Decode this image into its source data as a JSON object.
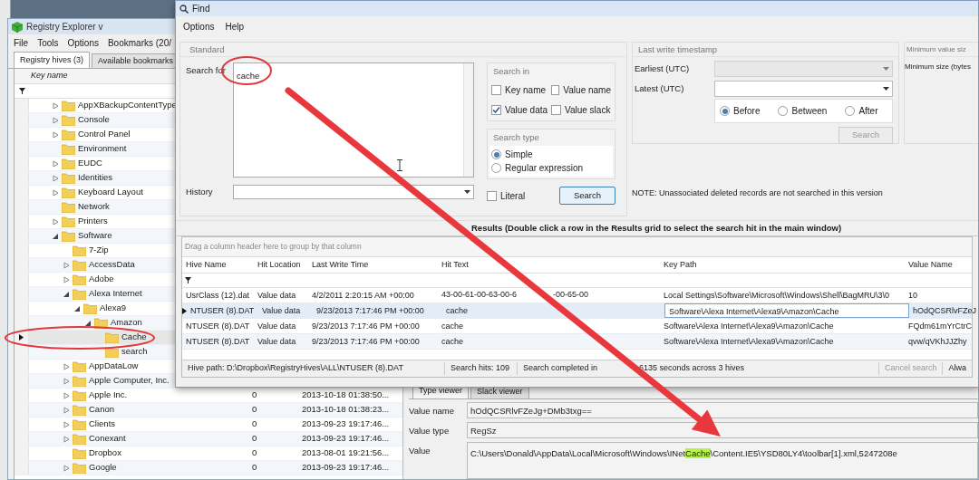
{
  "main_window": {
    "title": "Registry Explorer v",
    "menu": [
      "File",
      "Tools",
      "Options",
      "Bookmarks (20/"
    ],
    "tabs": [
      {
        "label": "Registry hives (3)",
        "selected": true
      },
      {
        "label": "Available bookmarks",
        "selected": false
      }
    ],
    "tree": {
      "column": "Key name",
      "items": [
        {
          "name": "AppXBackupContentType",
          "expanded": false,
          "selected": false
        },
        {
          "name": "Console",
          "expanded": false,
          "selected": false
        },
        {
          "name": "Control Panel",
          "expanded": false,
          "selected": false
        },
        {
          "name": "Environment",
          "selected": false
        },
        {
          "name": "EUDC",
          "expanded": false,
          "selected": false
        },
        {
          "name": "Identities",
          "expanded": false,
          "selected": false
        },
        {
          "name": "Keyboard Layout",
          "expanded": false,
          "selected": false
        },
        {
          "name": "Network",
          "selected": false
        },
        {
          "name": "Printers",
          "expanded": false,
          "selected": false
        },
        {
          "name": "Software",
          "expanded": true,
          "selected": false,
          "children": [
            {
              "name": "7-Zip",
              "selected": false
            },
            {
              "name": "AccessData",
              "expanded": false,
              "selected": false
            },
            {
              "name": "Adobe",
              "expanded": false,
              "selected": false
            },
            {
              "name": "Alexa Internet",
              "expanded": true,
              "selected": false,
              "children": [
                {
                  "name": "Alexa9",
                  "expanded": true,
                  "selected": false,
                  "children": [
                    {
                      "name": "Amazon",
                      "expanded": true,
                      "selected": false,
                      "children": [
                        {
                          "name": "Cache",
                          "selected": true
                        },
                        {
                          "name": "search",
                          "selected": false
                        }
                      ]
                    }
                  ]
                }
              ]
            },
            {
              "name": "AppDataLow",
              "expanded": false,
              "selected": false
            },
            {
              "name": "Apple Computer, Inc.",
              "expanded": false,
              "selected": false
            },
            {
              "name": "Apple Inc.",
              "expanded": false,
              "selected": false,
              "count": "0",
              "last_write": "2013-10-18 01:38:50..."
            },
            {
              "name": "Canon",
              "expanded": false,
              "selected": false,
              "count": "0",
              "last_write": "2013-10-18 01:38:23..."
            },
            {
              "name": "Clients",
              "expanded": false,
              "selected": false,
              "count": "0",
              "last_write": "2013-09-23 19:17:46..."
            },
            {
              "name": "Conexant",
              "expanded": false,
              "selected": false,
              "count": "0",
              "last_write": "2013-09-23 19:17:46..."
            },
            {
              "name": "Dropbox",
              "selected": false,
              "count": "0",
              "last_write": "2013-08-01 19:21:56..."
            },
            {
              "name": "Google",
              "expanded": false,
              "selected": false,
              "count": "0",
              "last_write": "2013-09-23 19:17:46..."
            }
          ]
        }
      ]
    },
    "type_viewer": {
      "tabs": [
        {
          "label": "Type viewer",
          "selected": true
        },
        {
          "label": "Slack viewer",
          "selected": false
        }
      ],
      "fields": [
        {
          "label": "Value name",
          "value": [
            {
              "text": "hOdQCSRlvFZeJg+DMb3txg==",
              "highlight": false
            }
          ]
        },
        {
          "label": "Value type",
          "value": [
            {
              "text": "RegSz",
              "highlight": false
            }
          ]
        },
        {
          "label": "Value",
          "value": [
            {
              "text": "C:\\Users\\Donald\\AppData\\Local\\Microsoft\\Windows\\INet",
              "highlight": false
            },
            {
              "text": "Cache",
              "highlight": true
            },
            {
              "text": "\\Content.IE5\\YSD80LY4\\toolbar[1].xml,5247208e",
              "highlight": false
            }
          ]
        }
      ]
    }
  },
  "find_dialog": {
    "title": "Find",
    "menu": [
      "Options",
      "Help"
    ],
    "standard": {
      "heading": "Standard",
      "search_label": "Search for",
      "search_value": "cache",
      "history_label": "History"
    },
    "search_in": {
      "heading": "Search in",
      "options": [
        {
          "label": "Key name",
          "checked": false
        },
        {
          "label": "Value name",
          "checked": false
        },
        {
          "label": "Value data",
          "checked": true
        },
        {
          "label": "Value slack",
          "checked": false
        }
      ]
    },
    "search_type": {
      "heading": "Search type",
      "options": [
        {
          "label": "Simple",
          "selected": true
        },
        {
          "label": "Regular expression",
          "selected": false
        }
      ]
    },
    "literal": {
      "label": "Literal",
      "checked": false
    },
    "search_button": "Search",
    "timestamp": {
      "heading": "Last write timestamp",
      "earliest_label": "Earliest (UTC)",
      "earliest_disabled": true,
      "latest_label": "Latest (UTC)",
      "modes": [
        {
          "label": "Before",
          "selected": true
        },
        {
          "label": "Between",
          "selected": false
        },
        {
          "label": "After",
          "selected": false
        }
      ],
      "search_button": {
        "label": "Search",
        "disabled": true
      }
    },
    "min_size": {
      "heading": "Minimum value siz",
      "label": "Minimum size (bytes"
    },
    "note": "NOTE: Unassociated deleted records are not searched in this version",
    "results_heading": "Results (Double click a row in the Results grid to select the search hit in the main window)",
    "grid": {
      "group_hint": "Drag a column header here to group by that column",
      "columns": [
        "Hive Name",
        "Hit Location",
        "Last Write Time",
        "Hit Text",
        "Key Path",
        "Value Name"
      ],
      "rows": [
        {
          "cells": [
            "UsrClass (12).dat",
            "Value data",
            "4/2/2011 2:20:15 AM +00:00",
            [
              "43-00-61-00-63-00-6",
              "-00-65-00"
            ],
            "Local Settings\\Software\\Microsoft\\Windows\\Shell\\BagMRU\\3\\0",
            "10"
          ],
          "selected": false
        },
        {
          "cells": [
            "NTUSER (8).DAT",
            "Value data",
            "9/23/2013 7:17:46 PM +00:00",
            "cache",
            "Software\\Alexa Internet\\Alexa9\\Amazon\\Cache",
            "hOdQCSRlvFZeJ"
          ],
          "selected": true
        },
        {
          "cells": [
            "NTUSER (8).DAT",
            "Value data",
            "9/23/2013 7:17:46 PM +00:00",
            "cache",
            "Software\\Alexa Internet\\Alexa9\\Amazon\\Cache",
            "FQdm61mYrCtrC"
          ],
          "selected": false
        },
        {
          "cells": [
            "NTUSER (8).DAT",
            "Value data",
            "9/23/2013 7:17:46 PM +00:00",
            "cache",
            "Software\\Alexa Internet\\Alexa9\\Amazon\\Cache",
            "qvw/qVKhJJZhy"
          ],
          "selected": false
        }
      ]
    },
    "status": {
      "hive_path": "Hive path: D:\\Dropbox\\RegistryHives\\ALL\\NTUSER (8).DAT",
      "hits": "Search hits: 109",
      "completed": [
        "Search completed in",
        "6135 seconds across 3 hives"
      ],
      "cancel": {
        "label": "Cancel search",
        "disabled": true
      },
      "extra": "Alwa"
    }
  }
}
